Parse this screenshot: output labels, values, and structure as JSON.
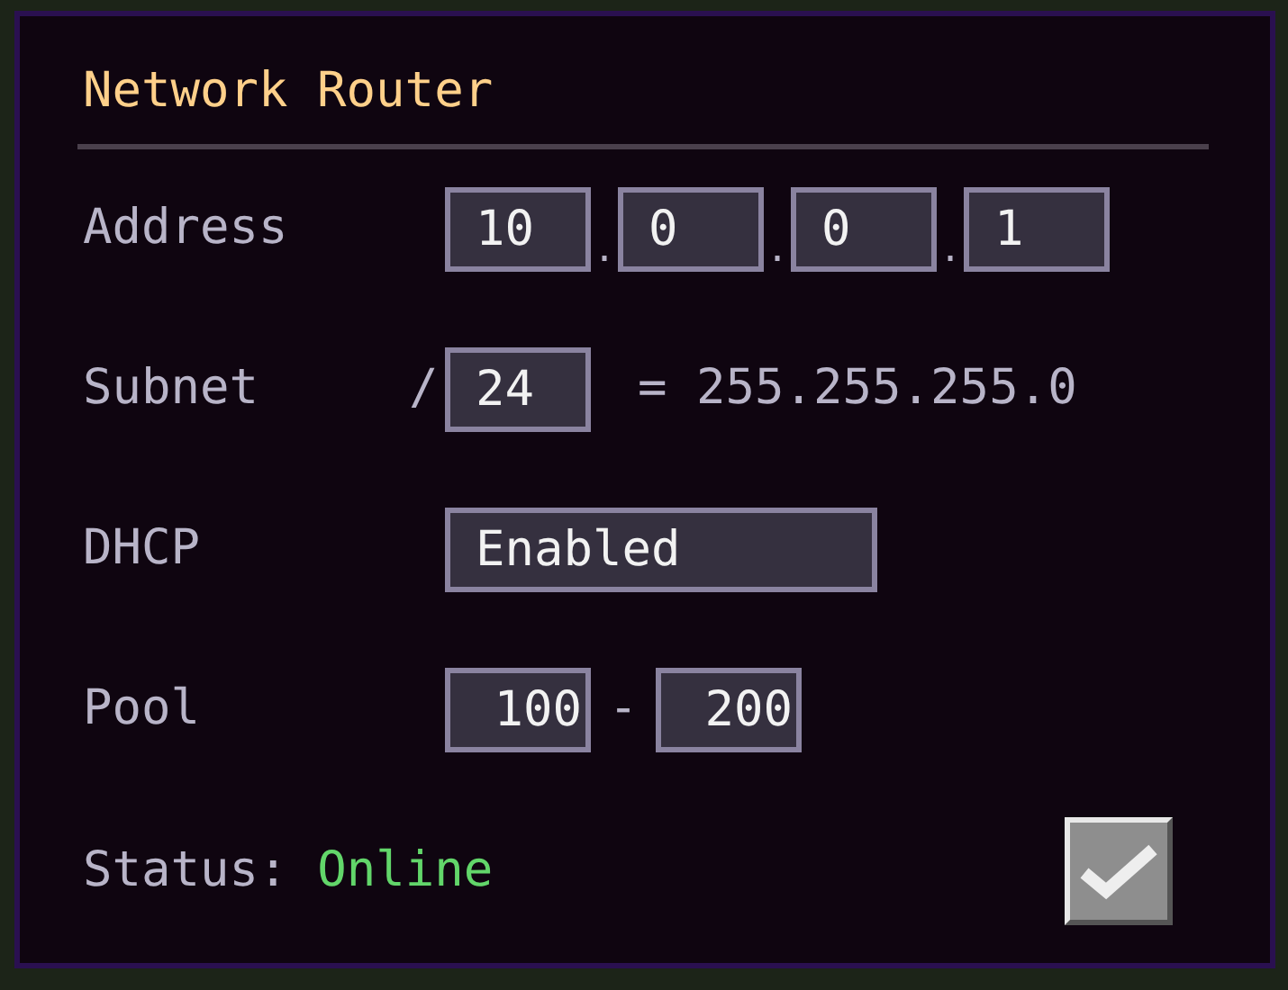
{
  "window": {
    "title": "Network Router"
  },
  "address": {
    "label": "Address",
    "octets": [
      "10",
      "0",
      "0",
      "1"
    ],
    "separator": "."
  },
  "subnet": {
    "label": "Subnet",
    "slash": "/",
    "prefix": "24",
    "mask": "= 255.255.255.0"
  },
  "dhcp": {
    "label": "DHCP",
    "value": "Enabled"
  },
  "pool": {
    "label": "Pool",
    "start": "100",
    "dash": "-",
    "end": "200"
  },
  "status": {
    "label": "Status:",
    "value": "Online"
  }
}
